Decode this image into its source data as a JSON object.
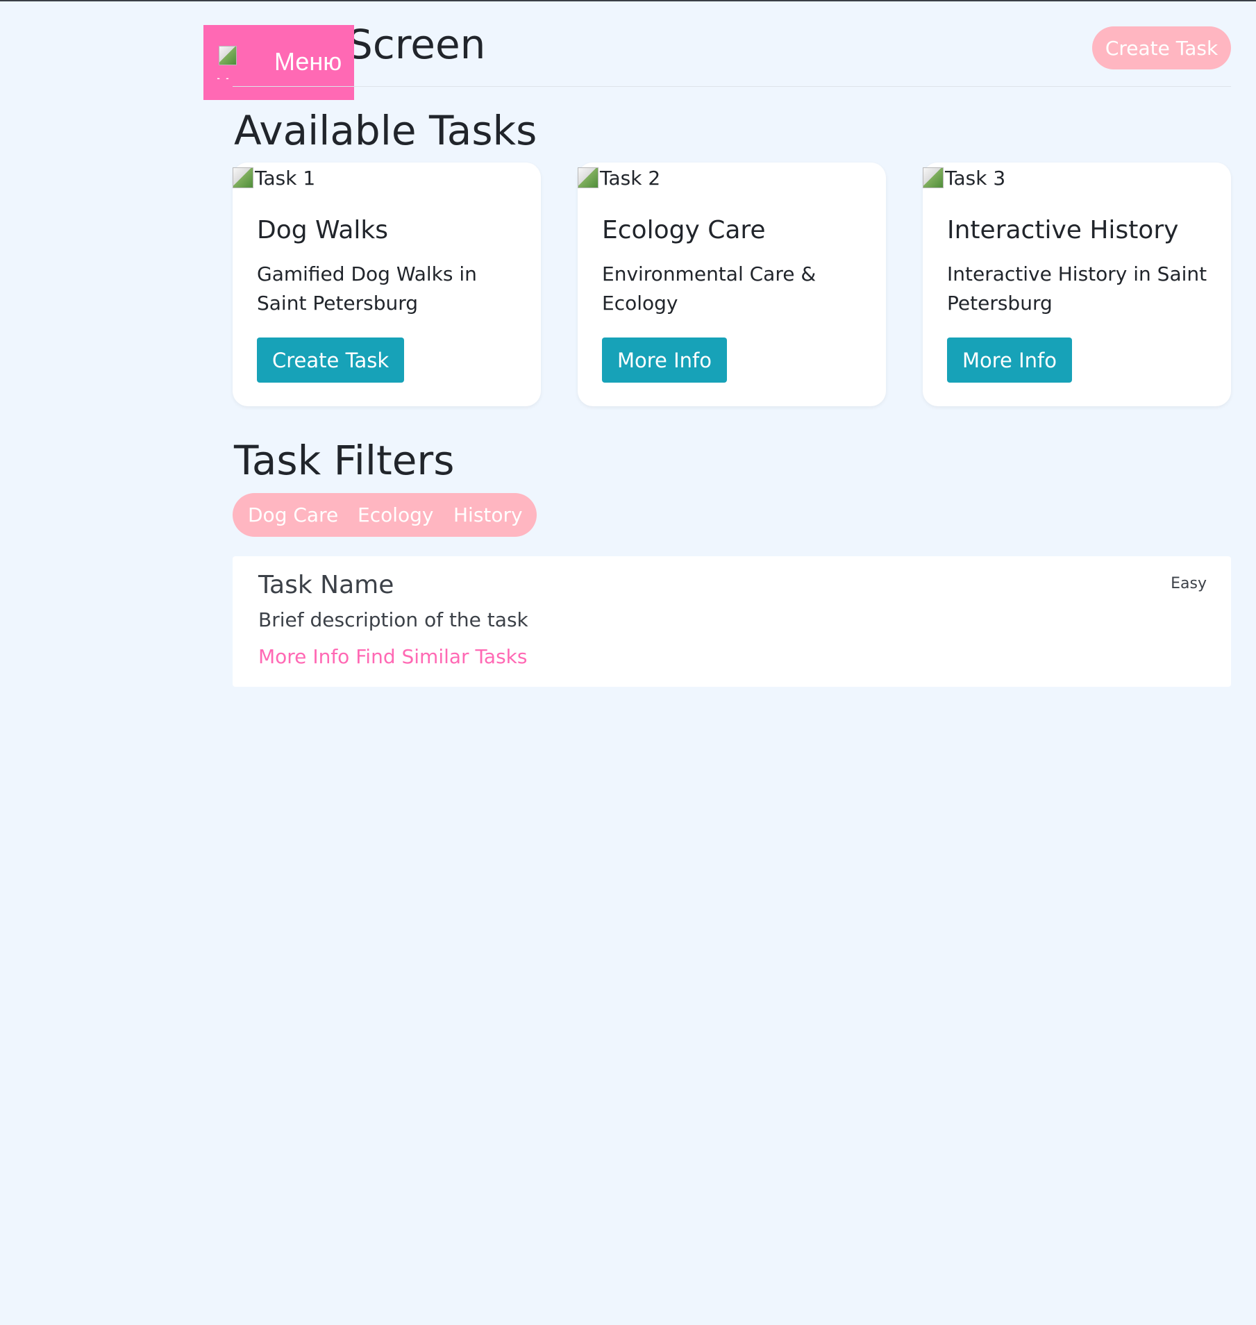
{
  "header": {
    "title": "Screen",
    "menu_button": {
      "image_alt": "Men",
      "label": "Меню"
    },
    "create_task_label": "Create Task"
  },
  "available_tasks": {
    "title": "Available Tasks",
    "cards": [
      {
        "image_alt": "Task 1",
        "title": "Dog Walks",
        "description": "Gamified Dog Walks in Saint Petersburg",
        "button_label": "Create Task"
      },
      {
        "image_alt": "Task 2",
        "title": "Ecology Care",
        "description": "Environmental Care & Ecology",
        "button_label": "More Info"
      },
      {
        "image_alt": "Task 3",
        "title": "Interactive History",
        "description": "Interactive History in Saint Petersburg",
        "button_label": "More Info"
      }
    ]
  },
  "task_filters": {
    "title": "Task Filters",
    "filters": [
      "Dog Care",
      "Ecology",
      "History"
    ]
  },
  "task_item": {
    "name": "Task Name",
    "description": "Brief description of the task",
    "link_more_info": "More Info",
    "link_find_similar": "Find Similar Tasks",
    "difficulty": "Easy"
  },
  "colors": {
    "page_background": "#eff6fe",
    "menu_pink": "#ff69b4",
    "pill_pink": "#ffb6c1",
    "button_teal": "#17a2b8",
    "link_pink": "#ff69b4",
    "text_dark": "#21252b"
  },
  "icons": {
    "broken_image": "broken-image-icon"
  }
}
